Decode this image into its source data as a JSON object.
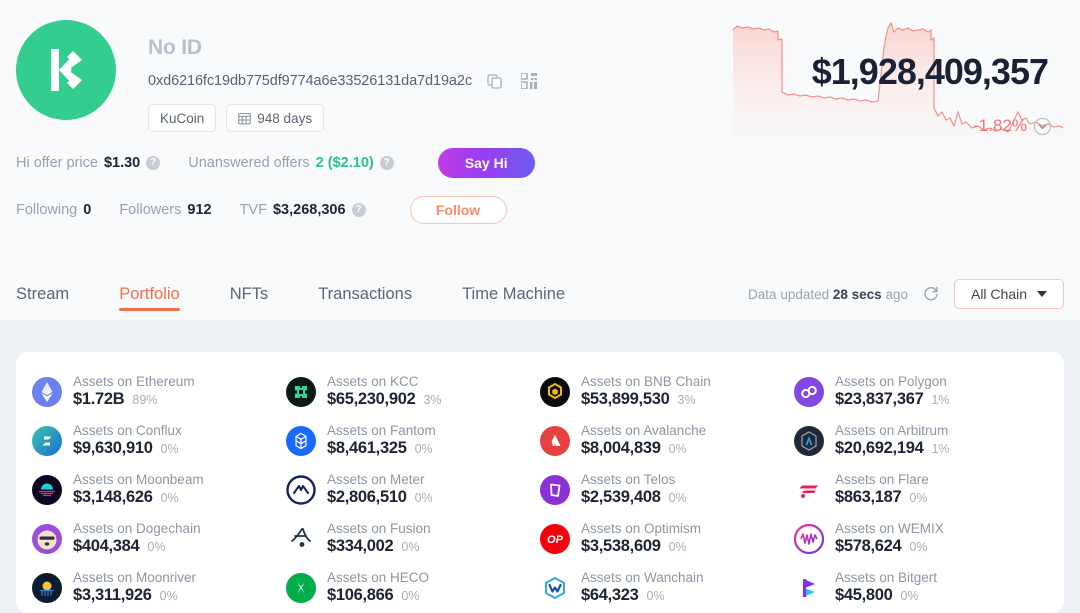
{
  "profile": {
    "avatar_icon": "kucoin-logo-icon",
    "avatar_color": "#32cd8f",
    "display_name": "No ID",
    "address": "0xd6216fc19db775df9774a6e33526131da7d19a2c",
    "copy_icon": "copy-icon",
    "qr_icon": "qr-code-icon",
    "tags": [
      {
        "label": "KuCoin",
        "icon": null
      },
      {
        "label": "948 days",
        "icon": "calendar-icon"
      }
    ]
  },
  "price": {
    "value": "$1,928,409,357",
    "change": "-1.82%",
    "change_color": "#f4726f",
    "clock_icon": "clock-history-icon"
  },
  "stats": {
    "row1": [
      {
        "label": "Hi offer price",
        "value": "$1.30",
        "value_color": "#1d2434",
        "help": "?"
      },
      {
        "label": "Unanswered offers",
        "value": "2 ($2.10)",
        "value_color": "#2bc48a",
        "help": "?"
      }
    ],
    "row2": [
      {
        "label": "Following",
        "value": "0",
        "value_color": "#1d2434",
        "help": null
      },
      {
        "label": "Followers",
        "value": "912",
        "value_color": "#1d2434",
        "help": null
      },
      {
        "label": "TVF",
        "value": "$3,268,306",
        "value_color": "#1d2434",
        "help": "?"
      }
    ],
    "say_hi_label": "Say Hi",
    "follow_label": "Follow"
  },
  "tabs": [
    {
      "label": "Stream",
      "active": false
    },
    {
      "label": "Portfolio",
      "active": true
    },
    {
      "label": "NFTs",
      "active": false
    },
    {
      "label": "Transactions",
      "active": false
    },
    {
      "label": "Time Machine",
      "active": false
    }
  ],
  "tab_right": {
    "updated_prefix": "Data updated",
    "updated_value": "28 secs",
    "updated_suffix": "ago",
    "refresh_icon": "refresh-icon",
    "chain_filter": "All Chain",
    "chevron_icon": "chevron-down-icon"
  },
  "assets": [
    {
      "name": "Assets on Ethereum",
      "value": "$1.72B",
      "pct": "89%",
      "icon": "ethereum-icon"
    },
    {
      "name": "Assets on KCC",
      "value": "$65,230,902",
      "pct": "3%",
      "icon": "kcc-icon"
    },
    {
      "name": "Assets on BNB Chain",
      "value": "$53,899,530",
      "pct": "3%",
      "icon": "bnb-icon"
    },
    {
      "name": "Assets on Polygon",
      "value": "$23,837,367",
      "pct": "1%",
      "icon": "polygon-icon"
    },
    {
      "name": "Assets on Arbitrum",
      "value": "$20,692,194",
      "pct": "1%",
      "icon": "arbitrum-icon"
    },
    {
      "name": "Assets on Conflux",
      "value": "$9,630,910",
      "pct": "0%",
      "icon": "conflux-icon"
    },
    {
      "name": "Assets on Fantom",
      "value": "$8,461,325",
      "pct": "0%",
      "icon": "fantom-icon"
    },
    {
      "name": "Assets on Avalanche",
      "value": "$8,004,839",
      "pct": "0%",
      "icon": "avalanche-icon"
    },
    {
      "name": "Assets on Optimism",
      "value": "$3,538,609",
      "pct": "0%",
      "icon": "optimism-icon"
    },
    {
      "name": "Assets on Moonriver",
      "value": "$3,311,926",
      "pct": "0%",
      "icon": "moonriver-icon"
    },
    {
      "name": "Assets on Moonbeam",
      "value": "$3,148,626",
      "pct": "0%",
      "icon": "moonbeam-icon"
    },
    {
      "name": "Assets on Meter",
      "value": "$2,806,510",
      "pct": "0%",
      "icon": "meter-icon"
    },
    {
      "name": "Assets on Telos",
      "value": "$2,539,408",
      "pct": "0%",
      "icon": "telos-icon"
    },
    {
      "name": "Assets on Flare",
      "value": "$863,187",
      "pct": "0%",
      "icon": "flare-icon"
    },
    {
      "name": "Assets on WEMIX",
      "value": "$578,624",
      "pct": "0%",
      "icon": "wemix-icon"
    },
    {
      "name": "Assets on Dogechain",
      "value": "$404,384",
      "pct": "0%",
      "icon": "dogechain-icon"
    },
    {
      "name": "Assets on Fusion",
      "value": "$334,002",
      "pct": "0%",
      "icon": "fusion-icon"
    },
    {
      "name": "Assets on HECO",
      "value": "$106,866",
      "pct": "0%",
      "icon": "heco-icon"
    },
    {
      "name": "Assets on Wanchain",
      "value": "$64,323",
      "pct": "0%",
      "icon": "wanchain-icon"
    },
    {
      "name": "Assets on Bitgert",
      "value": "$45,800",
      "pct": "0%",
      "icon": "bitgert-icon"
    }
  ]
}
